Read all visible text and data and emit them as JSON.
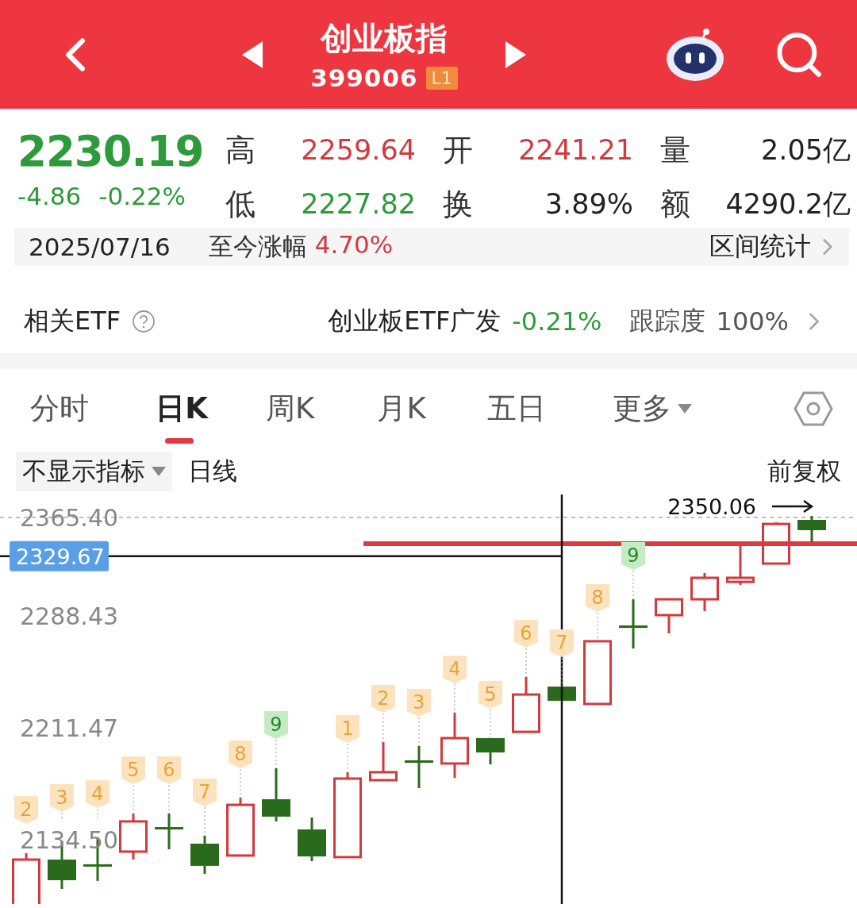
{
  "header": {
    "title": "创业板指",
    "code": "399006",
    "badge": "L1"
  },
  "quote": {
    "price": "2230.19",
    "change": "-4.86",
    "change_pct": "-0.22%",
    "stats": [
      {
        "label": "高",
        "value": "2259.64",
        "color": "#d23a3f"
      },
      {
        "label": "开",
        "value": "2241.21",
        "color": "#d23a3f"
      },
      {
        "label": "量",
        "value": "2.05亿",
        "color": "#222222"
      },
      {
        "label": "低",
        "value": "2227.82",
        "color": "#2d9a3c"
      },
      {
        "label": "换",
        "value": "3.89%",
        "color": "#222222"
      },
      {
        "label": "额",
        "value": "4290.2亿",
        "color": "#222222"
      }
    ]
  },
  "period": {
    "date": "2025/07/16",
    "label": "至今涨幅",
    "value": "4.70%",
    "link": "区间统计"
  },
  "etf": {
    "label": "相关ETF",
    "name": "创业板ETF广发",
    "change": "-0.21%",
    "tracking_label": "跟踪度",
    "tracking": "100%"
  },
  "tabs": [
    {
      "label": "分时",
      "selected": false
    },
    {
      "label": "日K",
      "selected": true
    },
    {
      "label": "周K",
      "selected": false
    },
    {
      "label": "月K",
      "selected": false
    },
    {
      "label": "五日",
      "selected": false
    },
    {
      "label": "更多",
      "selected": false,
      "kind": "menu"
    }
  ],
  "indicator": {
    "dropdown": "不显示指标",
    "period": "日线",
    "adjust": "前复权"
  },
  "chart": {
    "axis_labels": [
      "2365.40",
      "2288.43",
      "2211.47",
      "2134.50"
    ],
    "crosshair_price": "2329.67",
    "max_price": "2350.06",
    "sequence_marks": [
      {
        "text": "2",
        "kind": "count"
      },
      {
        "text": "3",
        "kind": "count"
      },
      {
        "text": "4",
        "kind": "count"
      },
      {
        "text": "5",
        "kind": "count"
      },
      {
        "text": "6",
        "kind": "count"
      },
      {
        "text": "7",
        "kind": "count"
      },
      {
        "text": "8",
        "kind": "count"
      },
      {
        "text": "9",
        "kind": "signal"
      },
      {
        "text": "1",
        "kind": "count"
      },
      {
        "text": "2",
        "kind": "count"
      },
      {
        "text": "3",
        "kind": "count"
      },
      {
        "text": "4",
        "kind": "count"
      },
      {
        "text": "5",
        "kind": "count"
      },
      {
        "text": "6",
        "kind": "count"
      },
      {
        "text": "7",
        "kind": "count"
      },
      {
        "text": "8",
        "kind": "count"
      },
      {
        "text": "9",
        "kind": "signal"
      }
    ]
  }
}
